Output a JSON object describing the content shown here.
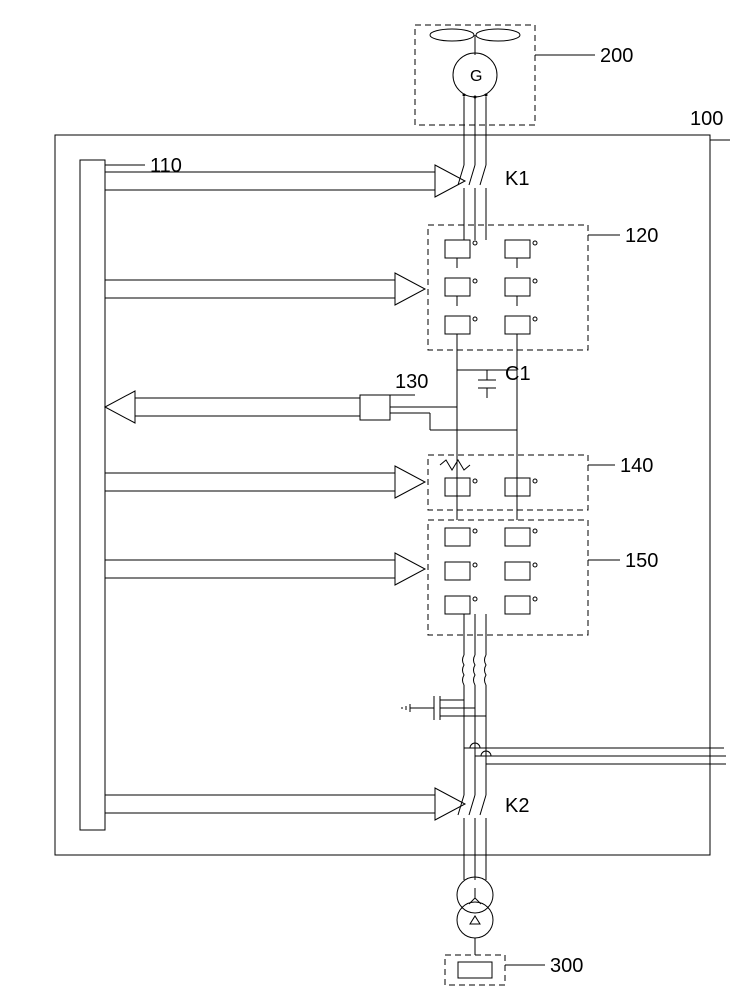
{
  "labels": {
    "generator": "G",
    "box200": "200",
    "box100": "100",
    "box110": "110",
    "k1": "K1",
    "box120": "120",
    "box130": "130",
    "c1": "C1",
    "box140": "140",
    "box150": "150",
    "k2": "K2",
    "box300": "300"
  }
}
